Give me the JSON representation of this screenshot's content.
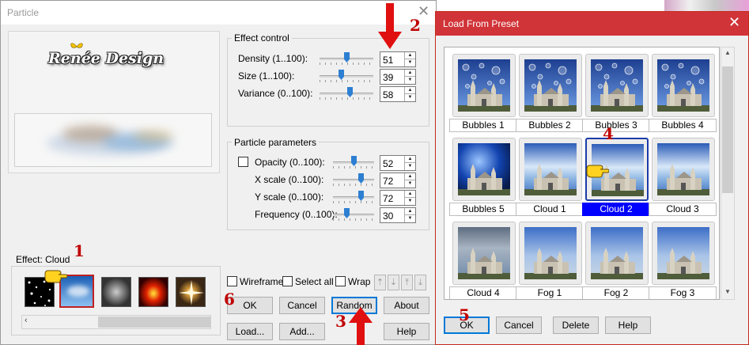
{
  "particle": {
    "title": "Particle",
    "close_glyph": "✕",
    "logo_text": "Renée Design",
    "effect_control": {
      "heading": "Effect control",
      "rows": [
        {
          "label": "Density (1..100):",
          "value": "51",
          "level": 51
        },
        {
          "label": "Size (1..100):",
          "value": "39",
          "level": 39
        },
        {
          "label": "Variance (0..100):",
          "value": "58",
          "level": 58
        }
      ]
    },
    "particle_parameters": {
      "heading": "Particle parameters",
      "rows": [
        {
          "label": "Opacity (0..100):",
          "value": "52",
          "level": 52
        },
        {
          "label": "X scale (0..100):",
          "value": "72",
          "level": 72
        },
        {
          "label": "Y scale (0..100):",
          "value": "72",
          "level": 72
        },
        {
          "label": "Frequency (0..100):",
          "value": "30",
          "level": 30
        }
      ]
    },
    "effect_label": "Effect: Cloud",
    "effect_thumbs": [
      "stars",
      "cloud",
      "smoke",
      "fire",
      "sparkle"
    ],
    "checks": {
      "wireframe": "Wireframe",
      "select_all": "Select all",
      "wrap": "Wrap"
    },
    "arrow_buttons": [
      "⇡",
      "⇣",
      "⤒",
      "⤓"
    ],
    "buttons": {
      "ok": "OK",
      "cancel": "Cancel",
      "random": "Random",
      "about": "About",
      "load": "Load...",
      "add": "Add...",
      "help": "Help"
    }
  },
  "preset": {
    "title": "Load From Preset",
    "close_glyph": "✕",
    "items": [
      {
        "label": "Bubbles 1",
        "style": "bubbles"
      },
      {
        "label": "Bubbles 2",
        "style": "bubbles"
      },
      {
        "label": "Bubbles 3",
        "style": "bubbles"
      },
      {
        "label": "Bubbles 4",
        "style": "bubbles"
      },
      {
        "label": "Bubbles 5",
        "style": "sphere"
      },
      {
        "label": "Cloud 1",
        "style": "cloud"
      },
      {
        "label": "Cloud 2",
        "style": "cloud",
        "selected": true
      },
      {
        "label": "Cloud 3",
        "style": "cloud"
      },
      {
        "label": "Cloud 4",
        "style": "dark"
      },
      {
        "label": "Fog 1",
        "style": "fog"
      },
      {
        "label": "Fog 2",
        "style": "fog"
      },
      {
        "label": "Fog 3",
        "style": "fog"
      }
    ],
    "buttons": {
      "ok": "OK",
      "cancel": "Cancel",
      "delete": "Delete",
      "help": "Help"
    },
    "scroll_up": "▲",
    "scroll_down": "▼"
  },
  "annotations": {
    "n1": "1",
    "n2": "2",
    "n3": "3",
    "n4": "4",
    "n5": "5",
    "n6": "6"
  },
  "colors": {
    "accent": "#2d7fd2",
    "annotation_red": "#c00000",
    "preset_title": "#d13438",
    "selection": "#0000ff"
  },
  "icons": {
    "pointer": "pointing-hand-icon",
    "arrow": "red-arrow-icon"
  }
}
